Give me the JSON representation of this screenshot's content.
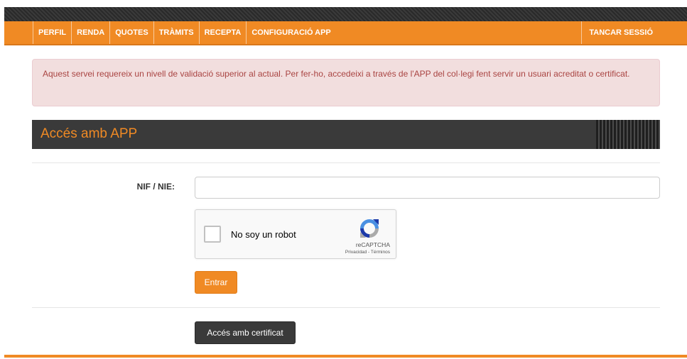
{
  "nav": {
    "items": [
      {
        "label": "PERFIL"
      },
      {
        "label": "RENDA"
      },
      {
        "label": "QUOTES"
      },
      {
        "label": "TRÀMITS"
      },
      {
        "label": "RECEPTA"
      },
      {
        "label": "CONFIGURACIÓ APP"
      }
    ],
    "logout_label": "TANCAR SESSIÓ"
  },
  "alert": {
    "message": "Aquest servei requereix un nivell de validació superior al actual. Per fer-ho, accedeixi a través de l'APP del col·legi fent servir un usuari acreditat o certificat."
  },
  "section": {
    "title": "Accés amb APP"
  },
  "form": {
    "nif_label": "NIF / NIE:",
    "nif_value": "",
    "submit_label": "Entrar",
    "cert_button_label": "Accés amb certificat"
  },
  "captcha": {
    "label": "No soy un robot",
    "brand": "reCAPTCHA",
    "links": "Privacidad - Términos"
  },
  "colors": {
    "accent": "#f08a24",
    "dark": "#3a3a3a",
    "alert_bg": "#f2dede",
    "alert_text": "#a94442"
  }
}
